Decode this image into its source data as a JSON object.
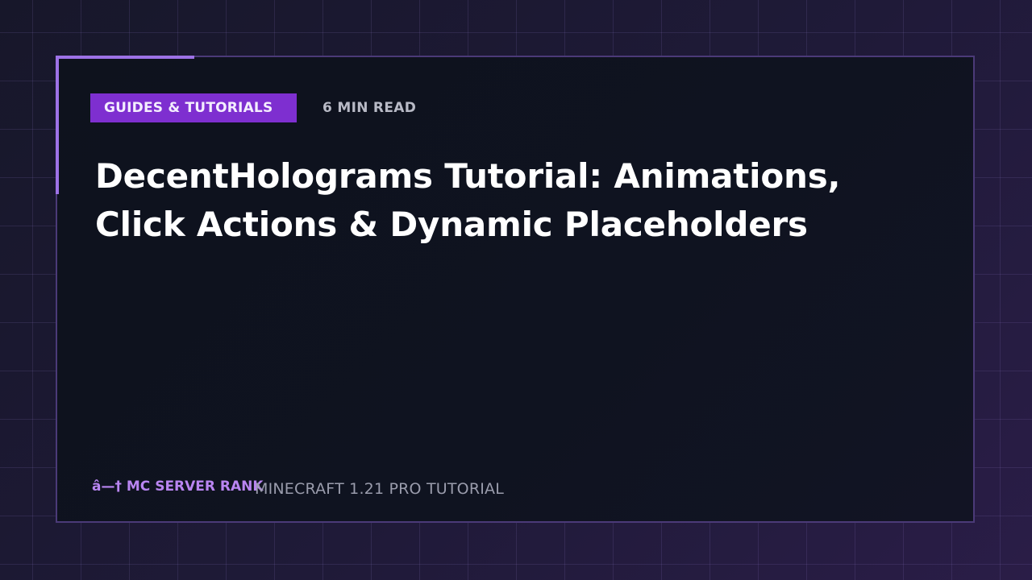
{
  "card": {
    "category": "GUIDES & TUTORIALS",
    "read_time": "6 MIN READ",
    "title": "DecentHolograms Tutorial: Animations, Click Actions & Dynamic Placeholders",
    "brand": "â—† MC SERVER RANK",
    "subtitle": "MINECRAFT 1.21 PRO TUTORIAL"
  },
  "colors": {
    "accent": "#9d72e6",
    "badge_bg": "#7e2fd0",
    "brand_text": "#b985f1",
    "card_bg": "#0e121d",
    "page_bg": "#1c1830"
  }
}
